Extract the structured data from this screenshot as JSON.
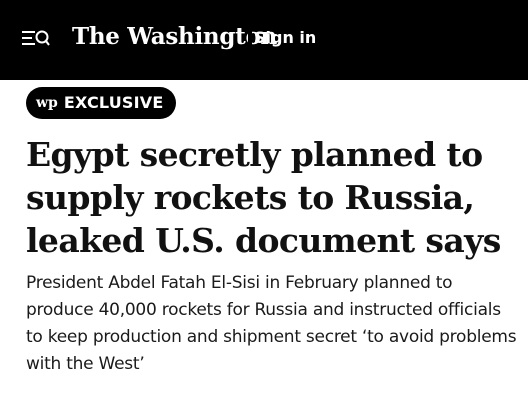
{
  "header": {
    "menu_icon": "menu-icon",
    "search_icon": "search-icon",
    "masthead": "The Washington",
    "signin_label": "Sign in",
    "background_color": "#000000",
    "text_color": "#ffffff"
  },
  "article": {
    "badge_logo": "wp",
    "badge_label": "EXCLUSIVE",
    "headline": "Egypt secretly planned to supply rockets to Russia, leaked U.S. document says",
    "subheadline": "President Abdel Fatah El-Sisi in February planned to produce 40,000 rockets for Russia and instructed officials to keep production and shipment secret ‘to avoid problems with the West’"
  }
}
